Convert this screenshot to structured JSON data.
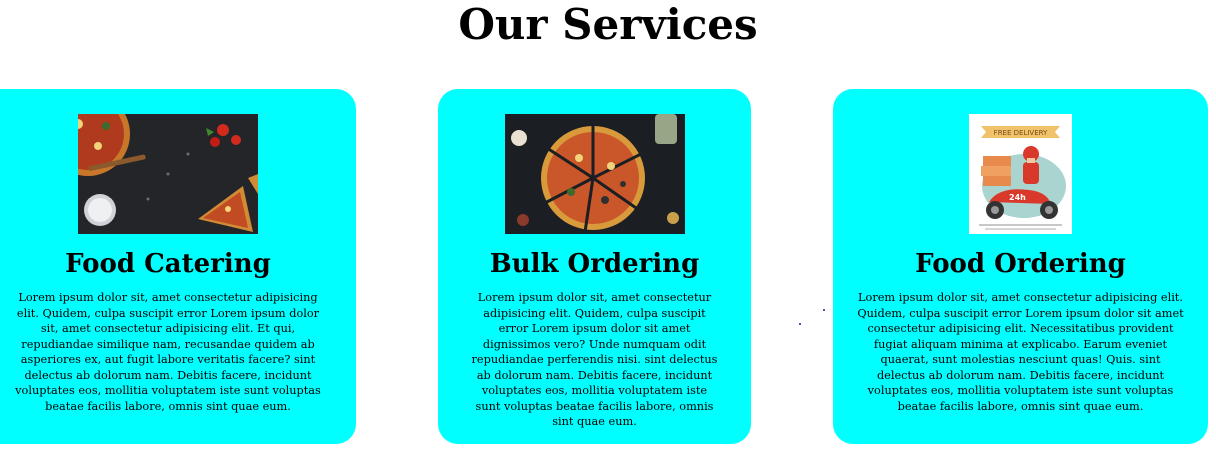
{
  "page": {
    "title": "Our Services"
  },
  "cards": [
    {
      "title": "Food Catering",
      "image_icon": "pizza-table-photo",
      "text": "Lorem ipsum dolor sit, amet consectetur adipisicing elit. Quidem, culpa suscipit error Lorem ipsum dolor sit, amet consectetur adipisicing elit. Et qui, repudiandae similique nam, recusandae quidem ab asperiores ex, aut fugit labore veritatis facere? sint delectus ab dolorum nam. Debitis facere, incidunt voluptates eos, mollitia voluptatem iste sunt voluptas beatae facilis labore, omnis sint quae eum."
    },
    {
      "title": "Bulk Ordering",
      "image_icon": "sliced-pizza-photo",
      "text": "Lorem ipsum dolor sit, amet consectetur adipisicing elit. Quidem, culpa suscipit error Lorem ipsum dolor sit amet dignissimos vero? Unde numquam odit repudiandae perferendis nisi. sint delectus ab dolorum nam. Debitis facere, incidunt voluptates eos, mollitia voluptatem iste sunt voluptas beatae facilis labore, omnis sint quae eum."
    },
    {
      "title": "Food Ordering",
      "image_icon": "delivery-scooter-illustration",
      "image_banner": "FREE DELIVERY",
      "image_badge": "24h",
      "text": "Lorem ipsum dolor sit, amet consectetur adipisicing elit. Quidem, culpa suscipit error Lorem ipsum dolor sit amet consectetur adipisicing elit. Necessitatibus provident fugiat aliquam minima at explicabo. Earum eveniet quaerat, sunt molestias nesciunt quas! Quis. sint delectus ab dolorum nam. Debitis facere, incidunt voluptates eos, mollitia voluptatem iste sunt voluptas beatae facilis labore, omnis sint quae eum."
    }
  ],
  "colors": {
    "card_bg": "#00ffff",
    "page_bg": "#ffffff",
    "text": "#000000"
  }
}
